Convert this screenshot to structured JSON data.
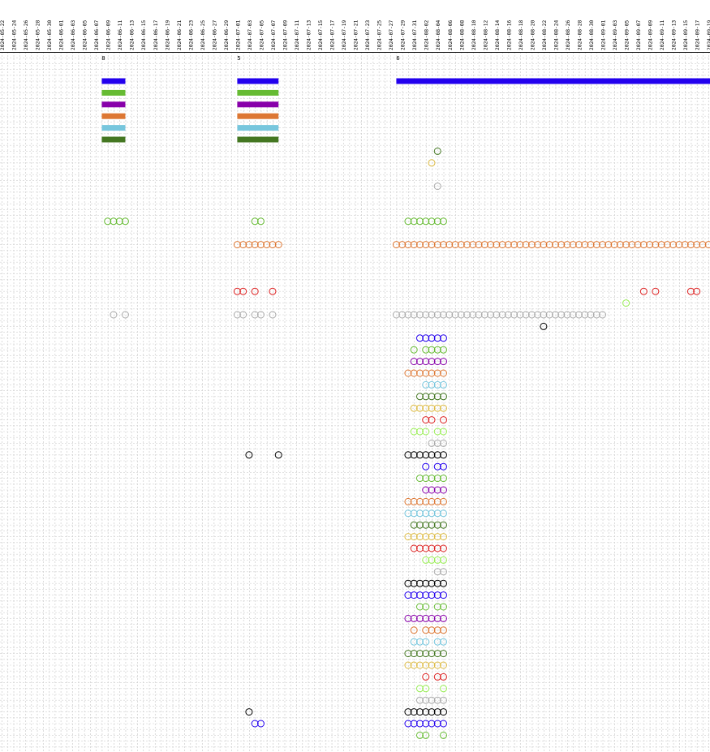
{
  "chart_data": {
    "type": "scatter",
    "x_axis": {
      "type": "date",
      "start": "2024-05-22",
      "end": "2024-09-20",
      "tick_step_days": 2,
      "label_format": "YYYY-MM-DD",
      "position": "top",
      "rotation": "vertical"
    },
    "grid": true,
    "legend": "none",
    "group_labels": [
      {
        "date": "2024-06-08",
        "label": "8"
      },
      {
        "date": "2024-07-01",
        "label": "5"
      },
      {
        "date": "2024-07-28",
        "label": "6"
      }
    ],
    "colors": [
      "#2200ee",
      "#66bb33",
      "#8800aa",
      "#dd7733",
      "#77c6dd",
      "#447722",
      "#ddbb44",
      "#dd2222",
      "#99ee55",
      "#aaaaaa",
      "#000000"
    ],
    "bars": [
      {
        "row": 0,
        "color_index": 0,
        "start": "2024-06-08",
        "end": "2024-06-12"
      },
      {
        "row": 1,
        "color_index": 1,
        "start": "2024-06-08",
        "end": "2024-06-12"
      },
      {
        "row": 2,
        "color_index": 2,
        "start": "2024-06-08",
        "end": "2024-06-12"
      },
      {
        "row": 3,
        "color_index": 3,
        "start": "2024-06-08",
        "end": "2024-06-12"
      },
      {
        "row": 4,
        "color_index": 4,
        "start": "2024-06-08",
        "end": "2024-06-12"
      },
      {
        "row": 5,
        "color_index": 5,
        "start": "2024-06-08",
        "end": "2024-06-12"
      },
      {
        "row": 0,
        "color_index": 0,
        "start": "2024-07-01",
        "end": "2024-07-08"
      },
      {
        "row": 1,
        "color_index": 1,
        "start": "2024-07-01",
        "end": "2024-07-08"
      },
      {
        "row": 2,
        "color_index": 2,
        "start": "2024-07-01",
        "end": "2024-07-08"
      },
      {
        "row": 3,
        "color_index": 3,
        "start": "2024-07-01",
        "end": "2024-07-08"
      },
      {
        "row": 4,
        "color_index": 4,
        "start": "2024-07-01",
        "end": "2024-07-08"
      },
      {
        "row": 5,
        "color_index": 5,
        "start": "2024-07-01",
        "end": "2024-07-08"
      },
      {
        "row": 0,
        "color_index": 0,
        "start": "2024-07-28",
        "end": "2024-09-20"
      }
    ],
    "point_groups": [
      {
        "row": 6,
        "color_index": 5,
        "dates": [
          "2024-08-04"
        ]
      },
      {
        "row": 7,
        "color_index": 6,
        "dates": [
          "2024-08-03"
        ]
      },
      {
        "row": 9,
        "color_index": 9,
        "dates": [
          "2024-08-04"
        ]
      },
      {
        "row": 12,
        "color_index": 1,
        "dates": [
          "2024-06-09",
          "2024-06-10",
          "2024-06-11",
          "2024-06-12"
        ]
      },
      {
        "row": 12,
        "color_index": 1,
        "dates": [
          "2024-07-04",
          "2024-07-05"
        ]
      },
      {
        "row": 12,
        "color_index": 1,
        "dates": [
          "2024-07-30",
          "2024-07-31",
          "2024-08-01",
          "2024-08-02",
          "2024-08-03",
          "2024-08-04",
          "2024-08-05"
        ]
      },
      {
        "row": 14,
        "color_index": 3,
        "dates": [
          "2024-07-01",
          "2024-07-02",
          "2024-07-03",
          "2024-07-04",
          "2024-07-05",
          "2024-07-06",
          "2024-07-07",
          "2024-07-08"
        ]
      },
      {
        "row": 14,
        "color_index": 3,
        "range": [
          "2024-07-28",
          "2024-09-20"
        ]
      },
      {
        "row": 18,
        "color_index": 7,
        "dates": [
          "2024-07-01",
          "2024-07-02",
          "2024-07-04",
          "2024-07-07"
        ]
      },
      {
        "row": 18,
        "color_index": 7,
        "dates": [
          "2024-09-08",
          "2024-09-10",
          "2024-09-16",
          "2024-09-17"
        ]
      },
      {
        "row": 19,
        "color_index": 8,
        "dates": [
          "2024-09-05"
        ]
      },
      {
        "row": 20,
        "color_index": 9,
        "dates": [
          "2024-06-10",
          "2024-06-12"
        ]
      },
      {
        "row": 20,
        "color_index": 9,
        "dates": [
          "2024-07-01",
          "2024-07-02",
          "2024-07-04",
          "2024-07-05",
          "2024-07-07"
        ]
      },
      {
        "row": 20,
        "color_index": 9,
        "range": [
          "2024-07-28",
          "2024-09-01"
        ]
      },
      {
        "row": 21,
        "color_index": 10,
        "dates": [
          "2024-08-22"
        ]
      },
      {
        "row": 22,
        "color_index": 0,
        "dates": [
          "2024-08-01",
          "2024-08-02",
          "2024-08-03",
          "2024-08-04",
          "2024-08-05"
        ]
      },
      {
        "row": 23,
        "color_index": 1,
        "dates": [
          "2024-07-31",
          "2024-08-02",
          "2024-08-03",
          "2024-08-04",
          "2024-08-05"
        ]
      },
      {
        "row": 24,
        "color_index": 2,
        "dates": [
          "2024-07-31",
          "2024-08-01",
          "2024-08-02",
          "2024-08-03",
          "2024-08-04",
          "2024-08-05"
        ]
      },
      {
        "row": 25,
        "color_index": 3,
        "dates": [
          "2024-07-30",
          "2024-07-31",
          "2024-08-01",
          "2024-08-02",
          "2024-08-03",
          "2024-08-04",
          "2024-08-05"
        ]
      },
      {
        "row": 26,
        "color_index": 4,
        "dates": [
          "2024-08-02",
          "2024-08-03",
          "2024-08-04",
          "2024-08-05"
        ]
      },
      {
        "row": 27,
        "color_index": 5,
        "dates": [
          "2024-08-01",
          "2024-08-02",
          "2024-08-03",
          "2024-08-04",
          "2024-08-05"
        ]
      },
      {
        "row": 28,
        "color_index": 6,
        "dates": [
          "2024-07-31",
          "2024-08-01",
          "2024-08-02",
          "2024-08-03",
          "2024-08-04",
          "2024-08-05"
        ]
      },
      {
        "row": 29,
        "color_index": 7,
        "dates": [
          "2024-08-02",
          "2024-08-03",
          "2024-08-05"
        ]
      },
      {
        "row": 30,
        "color_index": 8,
        "dates": [
          "2024-07-31",
          "2024-08-01",
          "2024-08-02",
          "2024-08-04",
          "2024-08-05"
        ]
      },
      {
        "row": 31,
        "color_index": 9,
        "dates": [
          "2024-08-03",
          "2024-08-04",
          "2024-08-05"
        ]
      },
      {
        "row": 32,
        "color_index": 10,
        "dates": [
          "2024-07-03",
          "2024-07-08"
        ]
      },
      {
        "row": 32,
        "color_index": 10,
        "dates": [
          "2024-07-30",
          "2024-07-31",
          "2024-08-01",
          "2024-08-02",
          "2024-08-03",
          "2024-08-04",
          "2024-08-05"
        ]
      },
      {
        "row": 33,
        "color_index": 0,
        "dates": [
          "2024-08-02",
          "2024-08-04",
          "2024-08-05"
        ]
      },
      {
        "row": 34,
        "color_index": 1,
        "dates": [
          "2024-08-01",
          "2024-08-02",
          "2024-08-03",
          "2024-08-04",
          "2024-08-05"
        ]
      },
      {
        "row": 35,
        "color_index": 2,
        "dates": [
          "2024-08-02",
          "2024-08-03",
          "2024-08-04",
          "2024-08-05"
        ]
      },
      {
        "row": 36,
        "color_index": 3,
        "dates": [
          "2024-07-30",
          "2024-07-31",
          "2024-08-01",
          "2024-08-02",
          "2024-08-03",
          "2024-08-04",
          "2024-08-05"
        ]
      },
      {
        "row": 37,
        "color_index": 4,
        "dates": [
          "2024-07-30",
          "2024-07-31",
          "2024-08-01",
          "2024-08-02",
          "2024-08-03",
          "2024-08-04",
          "2024-08-05"
        ]
      },
      {
        "row": 38,
        "color_index": 5,
        "dates": [
          "2024-07-31",
          "2024-08-01",
          "2024-08-02",
          "2024-08-03",
          "2024-08-04",
          "2024-08-05"
        ]
      },
      {
        "row": 39,
        "color_index": 6,
        "dates": [
          "2024-07-30",
          "2024-07-31",
          "2024-08-01",
          "2024-08-02",
          "2024-08-03",
          "2024-08-04",
          "2024-08-05"
        ]
      },
      {
        "row": 40,
        "color_index": 7,
        "dates": [
          "2024-07-31",
          "2024-08-01",
          "2024-08-02",
          "2024-08-03",
          "2024-08-04",
          "2024-08-05"
        ]
      },
      {
        "row": 41,
        "color_index": 8,
        "dates": [
          "2024-08-02",
          "2024-08-03",
          "2024-08-04",
          "2024-08-05"
        ]
      },
      {
        "row": 42,
        "color_index": 9,
        "dates": [
          "2024-08-04",
          "2024-08-05"
        ]
      },
      {
        "row": 43,
        "color_index": 10,
        "dates": [
          "2024-07-30",
          "2024-07-31",
          "2024-08-01",
          "2024-08-02",
          "2024-08-03",
          "2024-08-04",
          "2024-08-05"
        ]
      },
      {
        "row": 44,
        "color_index": 0,
        "dates": [
          "2024-07-30",
          "2024-07-31",
          "2024-08-01",
          "2024-08-02",
          "2024-08-03",
          "2024-08-04",
          "2024-08-05"
        ]
      },
      {
        "row": 45,
        "color_index": 1,
        "dates": [
          "2024-08-01",
          "2024-08-02",
          "2024-08-04",
          "2024-08-05"
        ]
      },
      {
        "row": 46,
        "color_index": 2,
        "dates": [
          "2024-07-30",
          "2024-07-31",
          "2024-08-01",
          "2024-08-02",
          "2024-08-03",
          "2024-08-04",
          "2024-08-05"
        ]
      },
      {
        "row": 47,
        "color_index": 3,
        "dates": [
          "2024-07-31",
          "2024-08-02",
          "2024-08-03",
          "2024-08-04",
          "2024-08-05"
        ]
      },
      {
        "row": 48,
        "color_index": 4,
        "dates": [
          "2024-07-31",
          "2024-08-01",
          "2024-08-02",
          "2024-08-04",
          "2024-08-05"
        ]
      },
      {
        "row": 49,
        "color_index": 5,
        "dates": [
          "2024-07-30",
          "2024-07-31",
          "2024-08-01",
          "2024-08-02",
          "2024-08-03",
          "2024-08-04",
          "2024-08-05"
        ]
      },
      {
        "row": 50,
        "color_index": 6,
        "dates": [
          "2024-07-30",
          "2024-07-31",
          "2024-08-01",
          "2024-08-02",
          "2024-08-03",
          "2024-08-04",
          "2024-08-05"
        ]
      },
      {
        "row": 51,
        "color_index": 7,
        "dates": [
          "2024-08-02",
          "2024-08-04",
          "2024-08-05"
        ]
      },
      {
        "row": 52,
        "color_index": 8,
        "dates": [
          "2024-08-01",
          "2024-08-02",
          "2024-08-05"
        ]
      },
      {
        "row": 53,
        "color_index": 9,
        "dates": [
          "2024-08-01",
          "2024-08-02",
          "2024-08-03",
          "2024-08-04",
          "2024-08-05"
        ]
      },
      {
        "row": 54,
        "color_index": 10,
        "dates": [
          "2024-07-03"
        ]
      },
      {
        "row": 54,
        "color_index": 10,
        "dates": [
          "2024-07-30",
          "2024-07-31",
          "2024-08-01",
          "2024-08-02",
          "2024-08-03",
          "2024-08-04",
          "2024-08-05"
        ]
      },
      {
        "row": 55,
        "color_index": 0,
        "dates": [
          "2024-07-04",
          "2024-07-05"
        ]
      },
      {
        "row": 55,
        "color_index": 0,
        "dates": [
          "2024-07-30",
          "2024-07-31",
          "2024-08-01",
          "2024-08-02",
          "2024-08-03",
          "2024-08-04",
          "2024-08-05"
        ]
      },
      {
        "row": 56,
        "color_index": 1,
        "dates": [
          "2024-08-01",
          "2024-08-02",
          "2024-08-05"
        ]
      }
    ]
  }
}
